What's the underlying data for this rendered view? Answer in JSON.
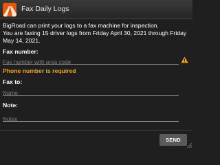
{
  "window": {
    "title": "Fax Daily Logs",
    "app_icon": "bigroad-logo-icon",
    "accent_color": "#e35a0d"
  },
  "intro": {
    "line1": "BigRoad can print your logs to a fax machine for inspection.",
    "line2": "You are faxing 15 driver logs from Friday April 30, 2021 through Friday May 14, 2021."
  },
  "fax_number": {
    "label": "Fax number:",
    "placeholder": "Fax number with area code",
    "value": "",
    "warning_icon": "warning-triangle-icon",
    "error": "Phone number is required",
    "error_color": "#f5a300"
  },
  "fax_to": {
    "label": "Fax to:",
    "placeholder": "Name",
    "value": ""
  },
  "note": {
    "label": "Note:",
    "placeholder": "Notes",
    "value": ""
  },
  "actions": {
    "send_label": "SEND"
  }
}
